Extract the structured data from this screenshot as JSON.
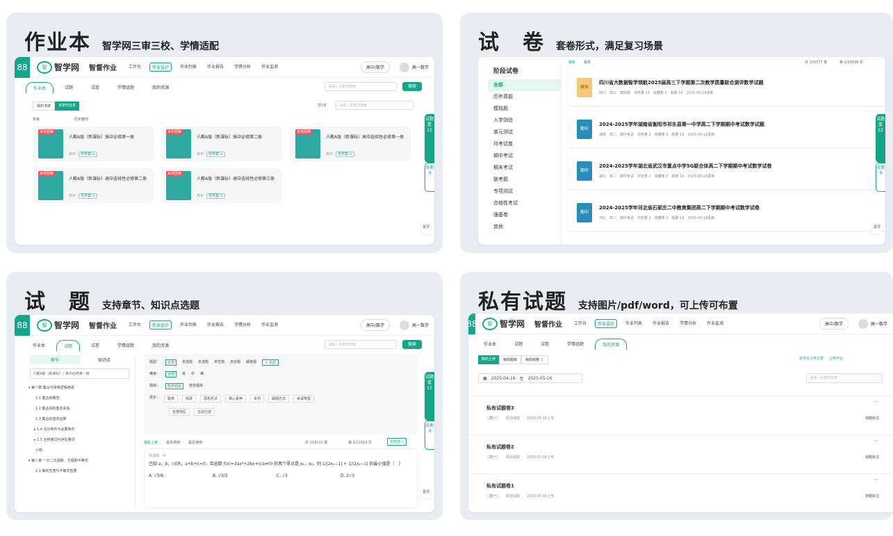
{
  "colors": {
    "brand": "#17a589",
    "panel_bg": "#e8edf3",
    "badge_red": "#e55"
  },
  "common": {
    "grid_icon": "88",
    "logo_name": "智学网",
    "logo_abbr": "智",
    "product": "智督作业",
    "nav": [
      "工作台",
      "作业设计",
      "作业列表",
      "作业报告",
      "学情分析",
      "作业监测"
    ],
    "subject": "高中/数学",
    "user": "高一数学",
    "search_btn": "搜索",
    "search_ph": "请输入关键词搜索",
    "side_a": "试题篮 12",
    "side_b": "去制卡",
    "top": "置顶"
  },
  "panel1": {
    "title": "作业本",
    "subtitle": "智学网三审三校、学情适配",
    "tabs": [
      "作业本",
      "试题",
      "试卷",
      "学情组题",
      "我的资源"
    ],
    "toggle": [
      "我的书架",
      "本校作业本"
    ],
    "count": "共5本",
    "filter_ph": "请输入关键词搜索",
    "filters": [
      "年级",
      "同步教材"
    ],
    "book_tag": "本校团审",
    "books": [
      {
        "title": "人教A版（新课标）高中必修第一册",
        "meta": "高中",
        "link": "导学案 >"
      },
      {
        "title": "人教A版（新课标）高中必修第二册",
        "meta": "高中",
        "link": "导学案 >"
      },
      {
        "title": "人教A版（新课标）高中选择性必修第一册",
        "meta": "高中",
        "link": "导学案 >"
      },
      {
        "title": "人教A版（新课标）高中选择性必修第二册",
        "meta": "高中",
        "link": "导学案 >"
      },
      {
        "title": "人教A版（新课标）高中选择性必修第三册",
        "meta": "高中",
        "link": "导学案 >"
      }
    ]
  },
  "panel2": {
    "title": "试　卷",
    "subtitle": "套卷形式，满足复习场景",
    "side_head": "阶段试卷",
    "side": [
      "全部",
      "历年真题",
      "模拟题",
      "入学测验",
      "单元测试",
      "月考试卷",
      "期中考试",
      "期末考试",
      "联考题",
      "专项测试",
      "合格性考试",
      "强基卷",
      "其他"
    ],
    "sort": [
      "最新",
      "最热"
    ],
    "total": "共 105377 卷",
    "page": "第 1/10538 页",
    "papers": [
      {
        "badge": "模拟",
        "title": "四川省大数据智学领航2025届高三下学期第二次教学质量联合测评数学试题",
        "meta": "四川　高三　模拟题　浏览量 13　收藏量 0　题量 19　2025-05-16更新"
      },
      {
        "badge": "期中",
        "title": "2024-2025学年湖南省衡阳市祁东县第一中学高二下学期期中考试数学试题",
        "meta": "湖南　高二　期中考试　浏览量 2　收藏量 0　题量 19　2025-05-16更新"
      },
      {
        "badge": "期中",
        "title": "2024-2025学年湖北省武汉市重点中学5G联合体高二下学期期中考试数学试卷",
        "meta": "湖北　高二　期中考试　浏览量 2　收藏量 0　题量 19　2025-05-16更新"
      },
      {
        "badge": "期中",
        "title": "2024-2025学年河北省石家庄二中教育集团高二下学期期中考试数学试卷",
        "meta": "河北　高二　期中考试　浏览量 1　收藏量 0　题量 19　2025-05-16更新"
      }
    ]
  },
  "panel3": {
    "title": "试　题",
    "subtitle": "支持章节、知识点选题",
    "tabs": [
      "作业本",
      "试题",
      "试卷",
      "学情组题",
      "我的资源"
    ],
    "seg": [
      "章节",
      "知识点"
    ],
    "book": "人教A版（新课标）/ 高中必修第一册",
    "tree": [
      "▾ 第一章 集合与常用逻辑用语",
      "1.1 集合的概念",
      "1.2 集合间的基本关系",
      "1.3 集合的基本运算",
      "▸ 1.4 充分条件与必要条件",
      "▸ 1.5 全称量词与存在量词",
      "小结",
      "▾ 第二章 一元二次函数、方程和不等式",
      "2.1 等式性质与不等式性质"
    ],
    "f_type_label": "题型：",
    "f_type": [
      "全部",
      "单选题",
      "多选题",
      "单空题",
      "多空题",
      "解答题",
      "+ 多选"
    ],
    "f_diff_label": "难度：",
    "f_diff": [
      "全部",
      "易",
      "中",
      "难"
    ],
    "f_lib_label": "题库：",
    "f_lib": [
      "智学题库",
      "校本题库"
    ],
    "f_more_label": "更多：",
    "f_more": [
      "题类",
      "情境",
      "思想方法",
      "核心素养",
      "年份",
      "解题方法",
      "考试类型"
    ],
    "f_more2": [
      "全部地区",
      "过滤已选"
    ],
    "sort": [
      "最新上架",
      "最多使用",
      "最近使用"
    ],
    "total": "共 119131 题",
    "page": "第 1/11914 页",
    "addall": "全部选入",
    "q_type": "单选题　中",
    "q_text": "已知 a，b，c∈R，a+b+c=0，若函数 f(x)=3ax²+2bx+c(a≠0) 的两个零点是 x₁，x₂，则 1/|2x₁−1| + 1/|2x₂−1| 的最小值是（　）",
    "opts": [
      "A. √3/6",
      "B. √3/3",
      "C. √3",
      "D. 2√3"
    ]
  },
  "panel4": {
    "title": "私有试题",
    "subtitle": "支持图片/pdf/word，可上传可布置",
    "tabs": [
      "作业本",
      "试题",
      "试卷",
      "学情组题",
      "我的资源"
    ],
    "subtabs": [
      "我的上传",
      "我的题库",
      "我的组卷 ⓘ"
    ],
    "links": [
      "去平台上传记录",
      "上传作业"
    ],
    "date_from": "2025-04-16",
    "date_sep": "至",
    "date_to": "2025-05-16",
    "search_ph": "请输入关键字检索",
    "items": [
      {
        "title": "私有试题卷3",
        "grade": "高一",
        "type": "原创试题",
        "date": "2025-05-16上传",
        "action": "划题标注"
      },
      {
        "title": "私有试题卷2",
        "grade": "高一",
        "type": "原创试题",
        "date": "2025-05-16上传",
        "action": "划题标注"
      },
      {
        "title": "私有试题卷1",
        "grade": "高一",
        "type": "原创试题",
        "date": "2025-05-16上传",
        "action": "划题标注"
      }
    ],
    "more": "···"
  }
}
